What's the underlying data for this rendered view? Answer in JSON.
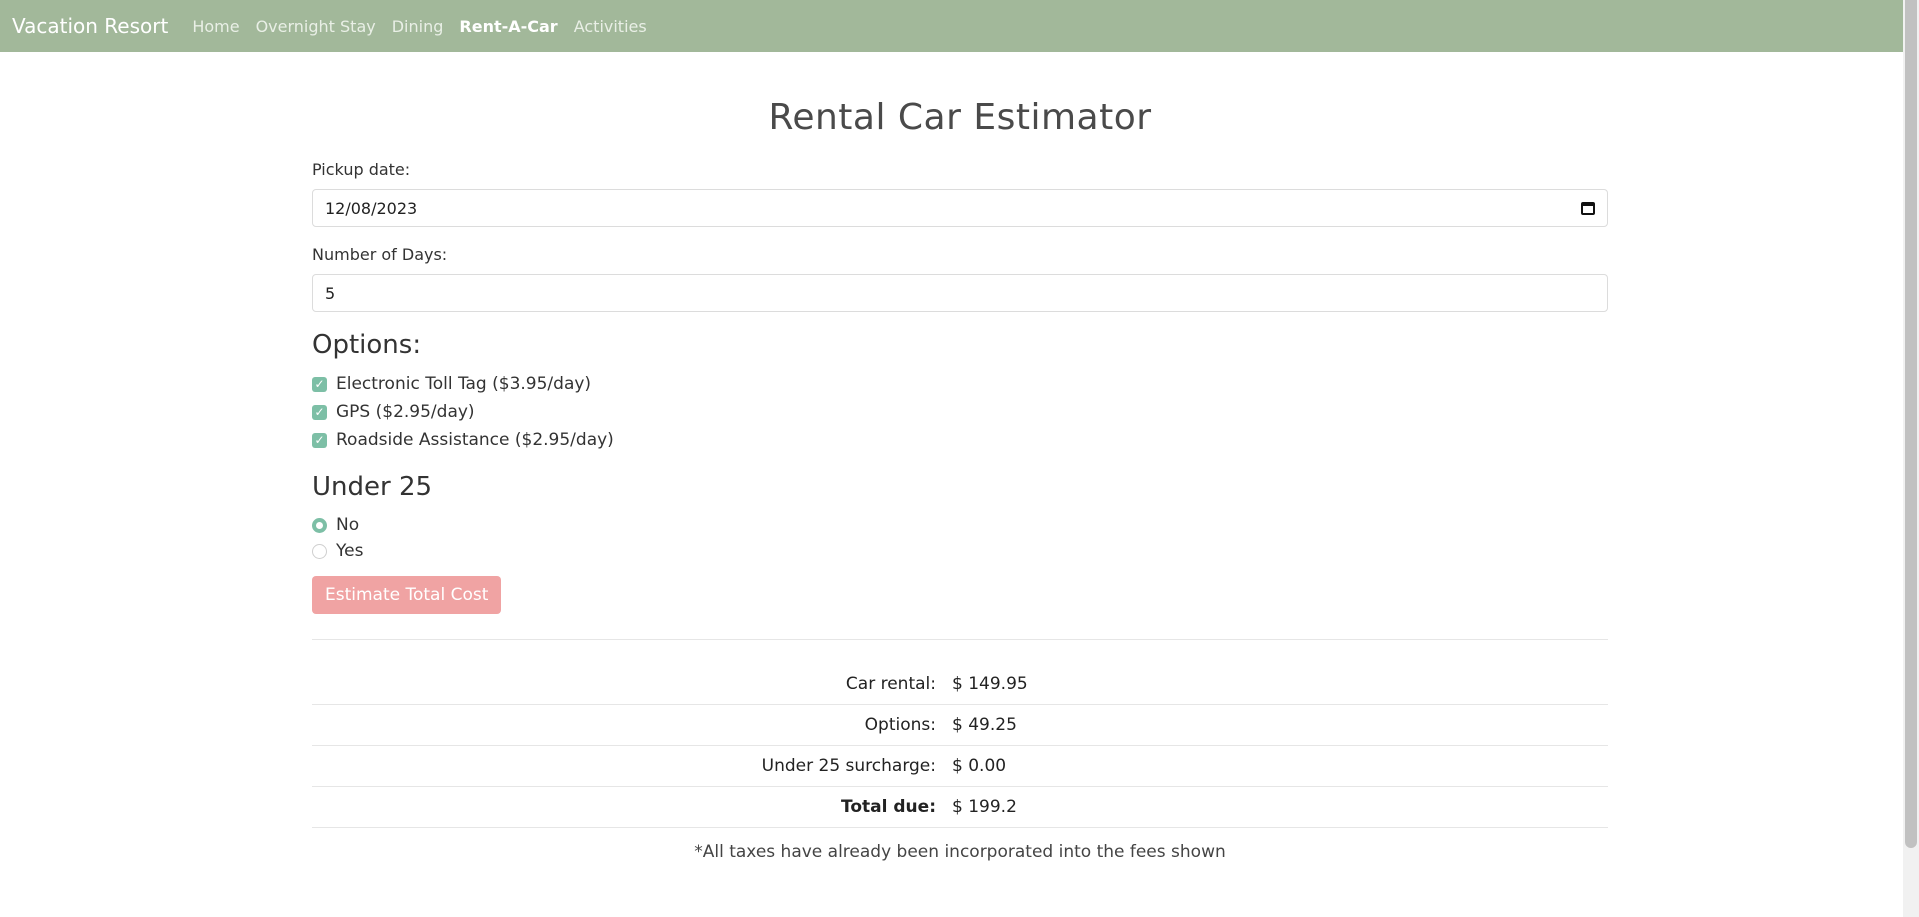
{
  "nav": {
    "brand": "Vacation Resort",
    "links": [
      "Home",
      "Overnight Stay",
      "Dining",
      "Rent-A-Car",
      "Activities"
    ]
  },
  "page": {
    "title": "Rental Car Estimator"
  },
  "form": {
    "pickup_label": "Pickup date:",
    "pickup_value": "12/08/2023",
    "days_label": "Number of Days:",
    "days_value": "5",
    "options_heading": "Options:",
    "options": [
      {
        "label": "Electronic Toll Tag ($3.95/day)",
        "checked": true
      },
      {
        "label": "GPS ($2.95/day)",
        "checked": true
      },
      {
        "label": "Roadside Assistance ($2.95/day)",
        "checked": true
      }
    ],
    "under25_heading": "Under 25",
    "under25_options": [
      {
        "label": "No",
        "checked": true
      },
      {
        "label": "Yes",
        "checked": false
      }
    ],
    "submit_label": "Estimate Total Cost"
  },
  "results": {
    "rows": [
      {
        "label": "Car rental:",
        "value": "$ 149.95"
      },
      {
        "label": "Options:",
        "value": "$ 49.25"
      },
      {
        "label": "Under 25 surcharge:",
        "value": "$ 0.00"
      },
      {
        "label": "Total due:",
        "value": "$ 199.2"
      }
    ],
    "footnote": "*All taxes have already been incorporated into the fees shown"
  },
  "colors": {
    "navbar": "#a2b89a",
    "accent": "#7dbfa6",
    "button": "#f0a3a3"
  }
}
